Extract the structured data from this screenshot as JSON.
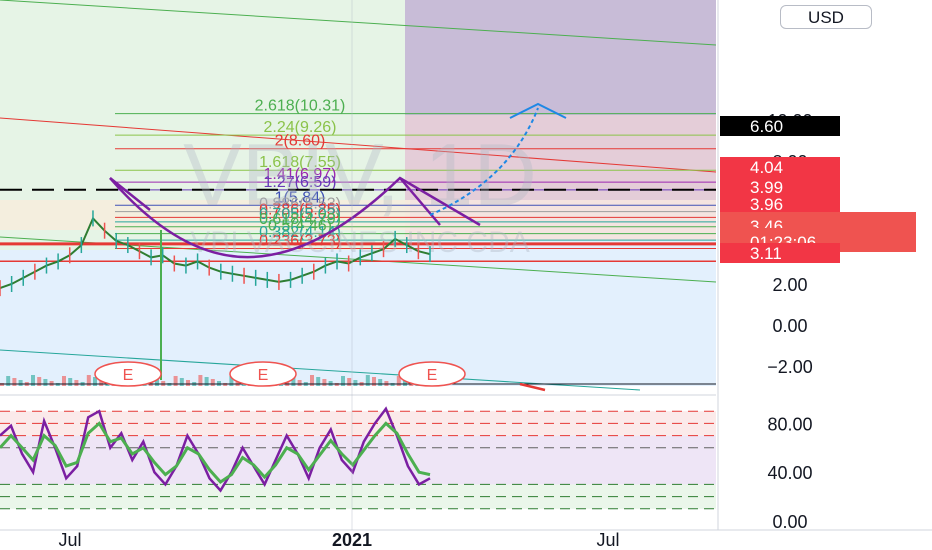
{
  "currency": "USD",
  "chart_data": [
    {
      "type": "line",
      "watermark": "VBIV, 1D",
      "watermark_company": "VBI VACCINES INC CDA",
      "x_tick_labels": [
        "Jul",
        "2021",
        "Jul"
      ],
      "y_tick_labels": [
        "10.00",
        "8.00",
        "6.00",
        "2.00",
        "0.00",
        "−2.00"
      ],
      "price_tags": [
        {
          "label": "6.60",
          "color": "#000000"
        },
        {
          "label": "4.04",
          "color": "#f23645"
        },
        {
          "label": "3.99",
          "color": "#f23645"
        },
        {
          "label": "3.96",
          "color": "#f23645"
        },
        {
          "label": "3.46",
          "sublabel": "01:23:06",
          "color": "#ef5350"
        },
        {
          "label": "3.11",
          "color": "#f23645"
        }
      ],
      "fib_levels": [
        {
          "label": "2.618(10.31)",
          "value": 10.31,
          "color": "#4caf50"
        },
        {
          "label": "2.24(9.26)",
          "value": 9.26,
          "color": "#8bc34a"
        },
        {
          "label": "2(8.60)",
          "value": 8.6,
          "color": "#e53935"
        },
        {
          "label": "1.618(7.55)",
          "value": 7.55,
          "color": "#8bc34a"
        },
        {
          "label": "1.41(6.97)",
          "value": 6.97,
          "color": "#9c27b0"
        },
        {
          "label": "1.27(6.59)",
          "value": 6.59,
          "color": "#673ab7"
        },
        {
          "label": "1(5.84)",
          "value": 5.84,
          "color": "#3f51b5"
        },
        {
          "label": "0.886(5.53)",
          "value": 5.53,
          "color": "#9e9e9e"
        },
        {
          "label": "0.786(5.25)",
          "value": 5.25,
          "color": "#e53935"
        },
        {
          "label": "0.705(5.03)",
          "value": 5.03,
          "color": "#26a69a"
        },
        {
          "label": "0.618(4.79)",
          "value": 4.79,
          "color": "#4caf50"
        },
        {
          "label": "0.5(4.46)",
          "value": 4.46,
          "color": "#4caf50"
        },
        {
          "label": "0.382(4.14)",
          "value": 4.14,
          "color": "#26a69a"
        },
        {
          "label": "0.236(3.73)",
          "value": 3.73,
          "color": "#e53935"
        }
      ],
      "earnings_markers": [
        "E",
        "E",
        "E"
      ],
      "forecast_target": 6.6,
      "price_series": [
        1.8,
        2.0,
        2.3,
        2.6,
        2.9,
        3.1,
        3.4,
        3.9,
        5.2,
        4.6,
        4.1,
        3.9,
        3.6,
        3.3,
        3.4,
        3.0,
        2.9,
        3.1,
        2.8,
        2.6,
        2.5,
        2.4,
        2.3,
        2.2,
        2.1,
        2.2,
        2.4,
        2.6,
        2.9,
        3.1,
        3.0,
        3.3,
        3.5,
        3.7,
        4.2,
        3.9,
        3.6,
        3.46
      ]
    },
    {
      "type": "line",
      "panel": "oscillator",
      "y_tick_labels": [
        "80.00",
        "40.00",
        "0.00"
      ],
      "ylim": [
        0,
        100
      ],
      "levels": [
        90,
        80,
        70,
        60,
        30,
        20,
        10
      ],
      "series": [
        {
          "values": [
            70,
            78,
            55,
            40,
            82,
            60,
            35,
            45,
            85,
            90,
            60,
            72,
            50,
            65,
            40,
            30,
            45,
            70,
            55,
            35,
            25,
            40,
            60,
            45,
            30,
            50,
            70,
            55,
            35,
            60,
            75,
            50,
            40,
            65,
            80,
            92,
            70,
            45,
            30,
            35
          ],
          "color": "#7b1fa2"
        },
        {
          "values": [
            60,
            70,
            60,
            50,
            70,
            62,
            45,
            48,
            72,
            80,
            65,
            68,
            55,
            60,
            48,
            38,
            45,
            60,
            55,
            42,
            32,
            38,
            52,
            46,
            36,
            46,
            60,
            55,
            42,
            54,
            66,
            55,
            46,
            58,
            70,
            80,
            72,
            55,
            40,
            38
          ],
          "color": "#4caf50"
        }
      ]
    }
  ]
}
